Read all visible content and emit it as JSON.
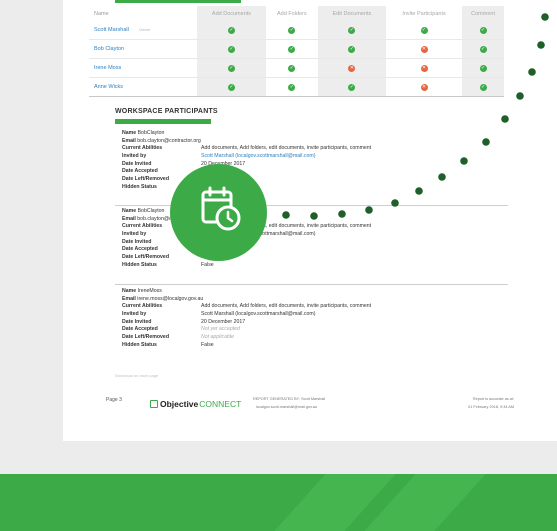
{
  "permissions_table": {
    "headers": [
      "Name",
      "Add Documents",
      "Add Folders",
      "Edit Documents",
      "Invite Participants",
      "Comment"
    ],
    "rows": [
      {
        "name": "Scott Marshall",
        "tag": "Owner",
        "perms": [
          "ok",
          "ok",
          "ok",
          "ok",
          "ok"
        ]
      },
      {
        "name": "Bob Clayton",
        "tag": "",
        "perms": [
          "ok",
          "ok",
          "ok",
          "no",
          "ok"
        ]
      },
      {
        "name": "Irene Moss",
        "tag": "",
        "perms": [
          "ok",
          "ok",
          "no",
          "no",
          "ok"
        ]
      },
      {
        "name": "Anne Wicks",
        "tag": "",
        "perms": [
          "ok",
          "ok",
          "ok",
          "no",
          "ok"
        ]
      }
    ]
  },
  "participants_section": {
    "title": "WORKSPACE PARTICIPANTS",
    "labels": {
      "name": "Name",
      "email": "Email",
      "abilities": "Current Abilities",
      "invited_by": "Invited by",
      "date_invited": "Date Invited",
      "date_accepted": "Date Accepted",
      "date_left": "Date Left/Removed",
      "hidden_status": "Hidden Status"
    },
    "entries": [
      {
        "name": "BobClayton",
        "email": "bob.clayton@contractor.org",
        "abilities": "Add documents, Add folders, edit documents, invite participants, comment",
        "invited_by": "Scott Marshall (localgov.scottmarshall@mail.com)",
        "date_invited": "20 December 2017",
        "date_accepted": "",
        "date_left": "",
        "hidden_status": ""
      },
      {
        "name": "BobClayton",
        "email": "bob.clayton@contractor.org",
        "abilities": "Add documents, Add folders, edit documents, invite participants, comment",
        "invited_by": "Scott Marshall (localgov.scottmarshall@mail.com)",
        "date_invited": "20 December 2017",
        "date_accepted": "Not yet accepted",
        "date_left": "Not applicable",
        "hidden_status": "False"
      },
      {
        "name": "IreneMoss",
        "email": "irene.moss@localgov.gov.au",
        "abilities": "Add documents, Add folders, edit documents, invite participants, comment",
        "invited_by": "Scott Marshall (localgov.scottmarshall@mail.com)",
        "date_invited": "20 December 2017",
        "date_accepted": "Not yet accepted",
        "date_left": "Not applicable",
        "hidden_status": "False"
      }
    ]
  },
  "download_note": "Download on each page",
  "footer": {
    "page": "Page 3",
    "logo_main": "Objective",
    "logo_sub": "CONNECT",
    "generated_line1": "REPORT GENERATED BY: Scott Marshall",
    "generated_line2": "localgov.scott.marshall@mail.gov.au",
    "accurate_line1": "Report is accurate as at:",
    "accurate_line2": "01 February 2018, 9:34 AM"
  },
  "overlay": {
    "icon": "calendar-clock-icon"
  },
  "colors": {
    "brand_green": "#3cab47",
    "deny_orange": "#e8643a",
    "link_blue": "#2b7fc1"
  }
}
